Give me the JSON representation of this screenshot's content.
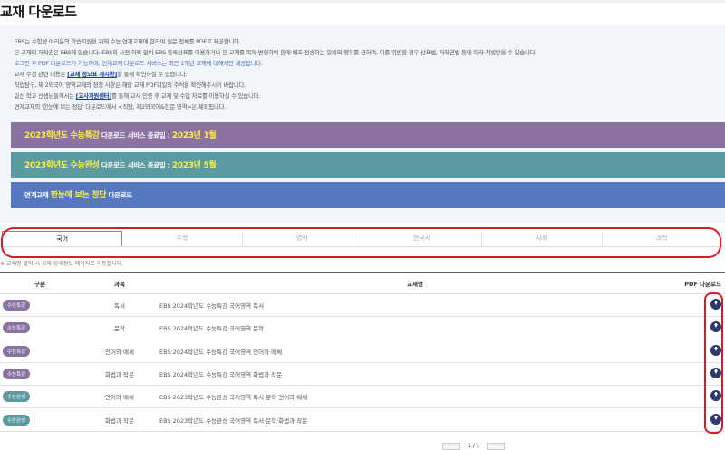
{
  "title": "교재 다운로드",
  "notices": [
    "EBS는 수험생 여러분의 학습지원을 위해 수능 연계교재에 한하여 원문 전체를 PDF로 제공합니다.",
    "본 교재의 저작권은 EBS에 있습니다. EBS의 사전 허락 없이 EBS 등록상표를 이용하거나 본 교재를 복제·변형하여 판매·배포·전송하는 일체의 행위를 금하며, 이를 위반할 경우 상표법, 저작권법 등에 따라 처벌받을 수 있습니다.",
    "로그인 후 PDF 다운로드가 가능하며, 연계교재 다운로드 서비스는 최근 1개년 교재에 대해서만 제공됩니다."
  ],
  "notice4": {
    "pre": "교재 수정 관련 내용은 ",
    "link": "[교재 정오표 게시판]",
    "post": "을 통해 확인하실 수 있습니다."
  },
  "notice5": "직업탐구, 제 2외국어 영역교재의 정정 사항은 해당 교재 PDF파일의 주석을 확인해주시기 바랍니다.",
  "notice6": {
    "pre": "일선 학교 선생님들께서는 ",
    "link": "[교사지원센터]",
    "post": "를 통해 교사 인증 후 교재 및 수업 자료를 이용하실 수 있습니다."
  },
  "notice7": "연계교재의 '한눈에 보는 정답' 다운로드에서 <직탐, 제2외국어&한문 영역>은 제외됩니다.",
  "banners": [
    {
      "hl": "2023학년도 수능특강",
      "mid": " 다운로드 서비스 종료일 : ",
      "date": "2023년 1월"
    },
    {
      "hl": "2023학년도 수능완성",
      "mid": " 다운로드 서비스 종료일 : ",
      "date": "2023년 5월"
    },
    {
      "pre": "연계교재 ",
      "hl": "한눈에 보는 정답",
      "post": " 다운로드"
    }
  ],
  "tabs": [
    "국어",
    "수학",
    "영어",
    "한국사",
    "사회",
    "과학"
  ],
  "note": "※ 교재명 클릭 시 교재 상세정보 페이지로 이동합니다.",
  "columns": [
    "구분",
    "과목",
    "교재명",
    "PDF 다운로드"
  ],
  "rows": [
    {
      "badge": "수능특강",
      "subject": "독서",
      "name": "EBS 2024학년도 수능특강 국어영역 독서"
    },
    {
      "badge": "수능특강",
      "subject": "문학",
      "name": "EBS 2024학년도 수능특강 국어영역 문학"
    },
    {
      "badge": "수능특강",
      "subject": "언어와 매체",
      "name": "EBS 2024학년도 수능특강 국어영역 언어와 매체"
    },
    {
      "badge": "수능특강",
      "subject": "화법과 작문",
      "name": "EBS 2024학년도 수능특강 국어영역 화법과 작문"
    },
    {
      "badge": "수능완성",
      "subject": "언어와 매체",
      "name": "EBS 2023학년도 수능완성 국어영역 독서·문학·언어와 매체"
    },
    {
      "badge": "수능완성",
      "subject": "화법과 작문",
      "name": "EBS 2023학년도 수능완성 국어영역 독서·문학·화법과 작문"
    }
  ],
  "colors": {
    "수능특강": "#8a73a3",
    "수능완성": "#5a9aa0"
  },
  "pager": "1 / 1"
}
